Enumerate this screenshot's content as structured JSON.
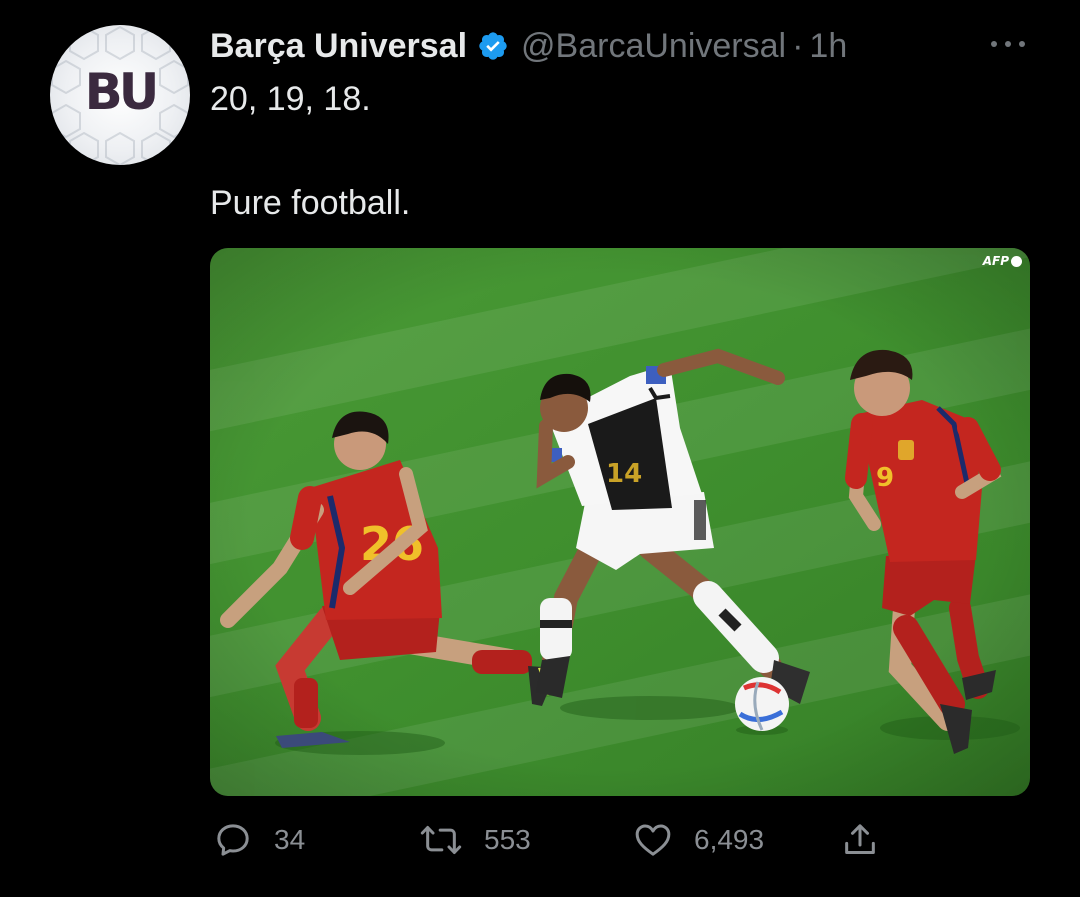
{
  "author": {
    "display_name": "Barça Universal",
    "handle": "@BarcaUniversal",
    "separator": "·",
    "time": "1h",
    "avatar_text": "BU"
  },
  "tweet": {
    "line1": "20, 19, 18.",
    "line2": "Pure football.",
    "image_watermark": "AFP",
    "image_alt_icon": "photo-of-football-match"
  },
  "actions": {
    "reply_count": "34",
    "retweet_count": "553",
    "like_count": "6,493"
  },
  "icons": {
    "verified": "verified-badge-icon",
    "more": "more-dots-icon",
    "reply": "reply-bubble-icon",
    "retweet": "retweet-arrows-icon",
    "like": "heart-icon",
    "share": "share-upload-icon"
  },
  "colors": {
    "background": "#000000",
    "text": "#e7e9ea",
    "secondary": "#71767b",
    "verified": "#1d9bf0",
    "pitch": "#3f8f2e"
  }
}
